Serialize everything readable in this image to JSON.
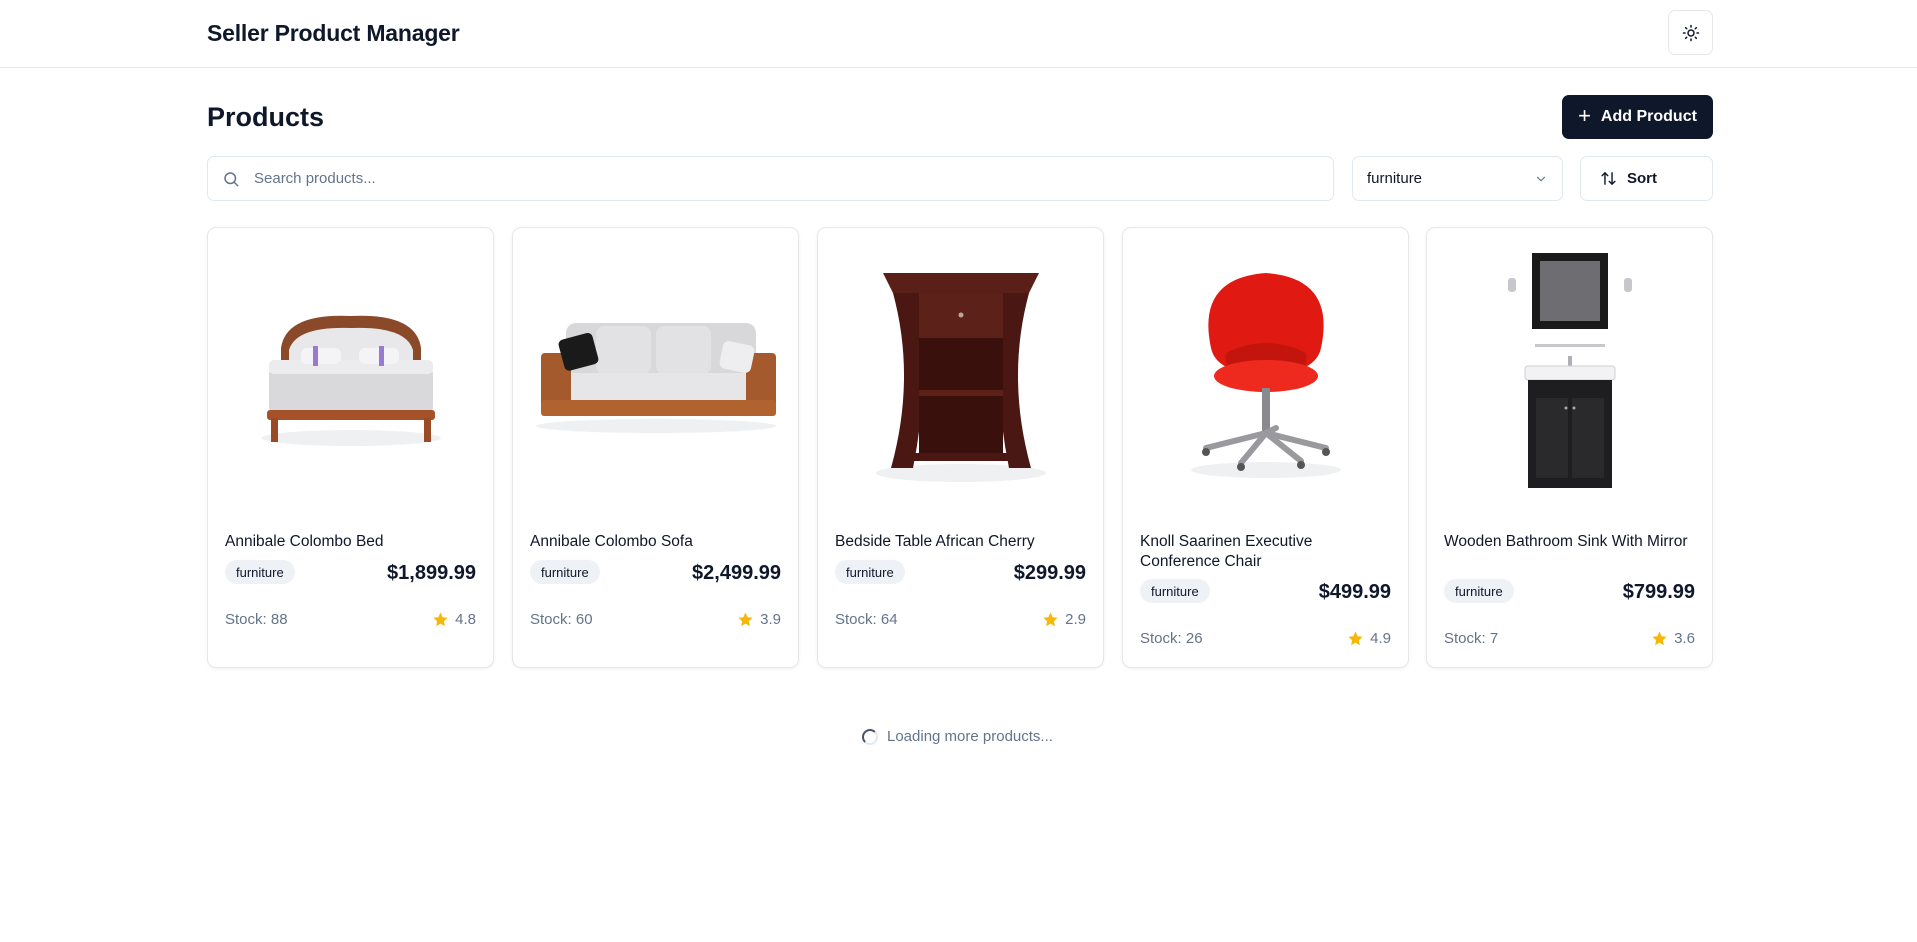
{
  "header": {
    "app_title": "Seller Product Manager",
    "theme_icon": "sun-icon"
  },
  "main": {
    "page_title": "Products",
    "add_button_label": "Add Product",
    "search": {
      "placeholder": "Search products...",
      "value": ""
    },
    "category_filter": {
      "selected": "furniture"
    },
    "sort_label": "Sort"
  },
  "products": [
    {
      "name": "Annibale Colombo Bed",
      "category": "furniture",
      "price": "$1,899.99",
      "stock": "Stock: 88",
      "rating": "4.8",
      "image": "bed"
    },
    {
      "name": "Annibale Colombo Sofa",
      "category": "furniture",
      "price": "$2,499.99",
      "stock": "Stock: 60",
      "rating": "3.9",
      "image": "sofa"
    },
    {
      "name": "Bedside Table African Cherry",
      "category": "furniture",
      "price": "$299.99",
      "stock": "Stock: 64",
      "rating": "2.9",
      "image": "bedside-table"
    },
    {
      "name": "Knoll Saarinen Executive Conference Chair",
      "category": "furniture",
      "price": "$499.99",
      "stock": "Stock: 26",
      "rating": "4.9",
      "image": "office-chair"
    },
    {
      "name": "Wooden Bathroom Sink With Mirror",
      "category": "furniture",
      "price": "$799.99",
      "stock": "Stock: 7",
      "rating": "3.6",
      "image": "bathroom-sink"
    }
  ],
  "loading_text": "Loading more products...",
  "colors": {
    "primary": "#0f172a",
    "muted_text": "#64748b",
    "border": "#e5e7eb",
    "badge_bg": "#eef2f6",
    "star": "#f5b70a"
  }
}
